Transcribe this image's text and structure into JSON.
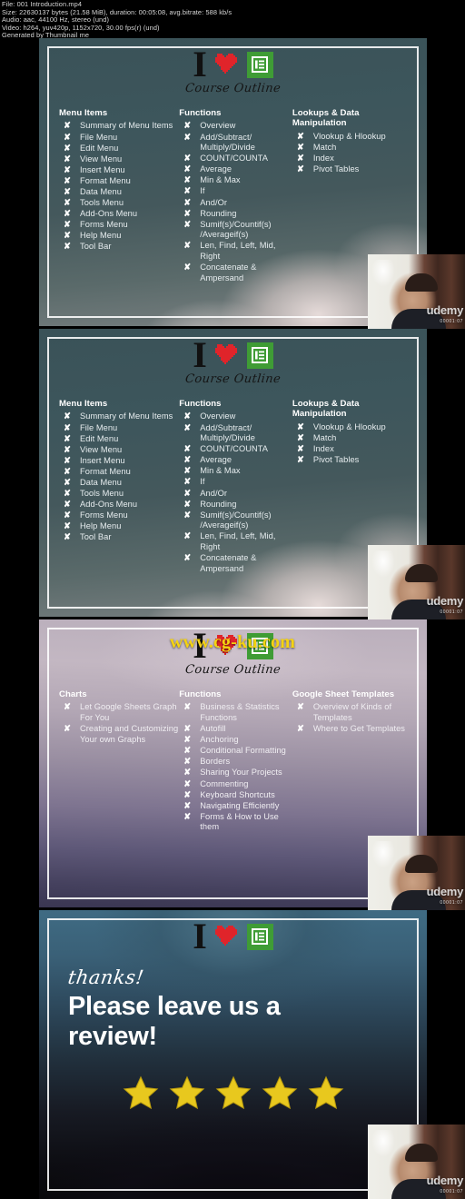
{
  "meta": {
    "line1": "File: 001 Introduction.mp4",
    "line2": "Size: 22630137 bytes (21.58 MiB), duration: 00:05:08, avg.bitrate: 588 kb/s",
    "line3": "Audio: aac, 44100 Hz, stereo (und)",
    "line4": "Video: h264, yuv420p, 1152x720, 30.00 fps(r) (und)",
    "line5": "Generated by Thumbnail me"
  },
  "logo": {
    "i_text": "I",
    "heart_icon": "heart-icon",
    "sheets_icon": "google-sheets-icon",
    "sheets_color": "#3f9c35",
    "heart_color": "#e0242a",
    "subtitle": "Course Outline"
  },
  "watermark": {
    "site": "www.cg-ku.com",
    "color": "#f5d311"
  },
  "webcam": {
    "brand": "udemy",
    "brand_sub": "00001:07"
  },
  "bullet_mark": "✘",
  "frames": [
    {
      "id": "frame-1",
      "type": "outline",
      "columns": [
        {
          "heading": "Menu Items",
          "items": [
            "Summary of Menu Items",
            "File Menu",
            "Edit Menu",
            "View Menu",
            "Insert Menu",
            "Format Menu",
            "Data Menu",
            "Tools Menu",
            "Add-Ons Menu",
            "Forms Menu",
            "Help Menu",
            "Tool Bar"
          ]
        },
        {
          "heading": "Functions",
          "items": [
            "Overview",
            "Add/Subtract/ Multiply/Divide",
            "COUNT/COUNTA",
            "Average",
            "Min & Max",
            "If",
            "And/Or",
            "Rounding",
            "Sumif(s)/Countif(s) /Averageif(s)",
            "Len, Find, Left, Mid, Right",
            "Concatenate & Ampersand"
          ]
        },
        {
          "heading": "Lookups & Data Manipulation",
          "items": [
            "Vlookup & Hlookup",
            "Match",
            "Index",
            "Pivot Tables"
          ]
        }
      ]
    },
    {
      "id": "frame-2",
      "type": "outline",
      "columns": [
        {
          "heading": "Menu Items",
          "items": [
            "Summary of Menu Items",
            "File Menu",
            "Edit Menu",
            "View Menu",
            "Insert Menu",
            "Format Menu",
            "Data Menu",
            "Tools Menu",
            "Add-Ons Menu",
            "Forms Menu",
            "Help Menu",
            "Tool Bar"
          ]
        },
        {
          "heading": "Functions",
          "items": [
            "Overview",
            "Add/Subtract/ Multiply/Divide",
            "COUNT/COUNTA",
            "Average",
            "Min & Max",
            "If",
            "And/Or",
            "Rounding",
            "Sumif(s)/Countif(s) /Averageif(s)",
            "Len, Find, Left, Mid, Right",
            "Concatenate & Ampersand"
          ]
        },
        {
          "heading": "Lookups & Data Manipulation",
          "items": [
            "Vlookup & Hlookup",
            "Match",
            "Index",
            "Pivot Tables"
          ]
        }
      ]
    },
    {
      "id": "frame-3",
      "type": "outline",
      "columns": [
        {
          "heading": "Charts",
          "items": [
            "Let Google Sheets Graph For You",
            "Creating and Customizing Your own Graphs"
          ]
        },
        {
          "heading": "Functions",
          "items": [
            "Business & Statistics Functions",
            "Autofill",
            "Anchoring",
            "Conditional Formatting",
            "Borders",
            "Sharing Your Projects",
            "Commenting",
            "Keyboard Shortcuts",
            "Navigating Efficiently",
            "Forms & How to Use them"
          ]
        },
        {
          "heading": "Google Sheet Templates",
          "items": [
            "Overview of Kinds of Templates",
            "Where to Get Templates"
          ]
        }
      ]
    },
    {
      "id": "frame-4",
      "type": "thanks",
      "script_text": "thanks!",
      "headline": "Please leave us a review!",
      "star_count": 5,
      "star_color": "#e8c81e"
    }
  ]
}
